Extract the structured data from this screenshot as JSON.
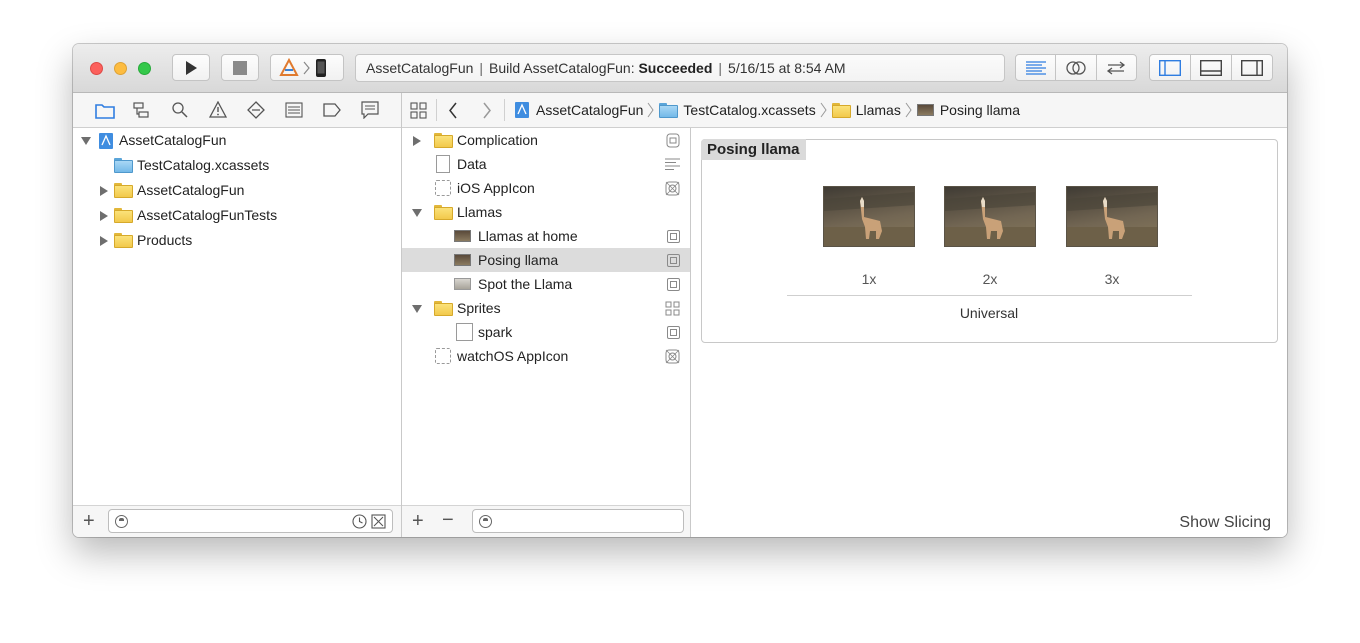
{
  "window": {
    "traffic_lights": {
      "close": "#fc605c",
      "minimize": "#fdbc40",
      "zoom": "#34c84a"
    },
    "toolbar": {
      "run_icon": "play-icon",
      "stop_icon": "stop-icon",
      "scheme_icon": "app-icon",
      "device_icon": "iphone-icon",
      "activity": {
        "project": "AssetCatalogFun",
        "build_prefix": "Build AssetCatalogFun:",
        "build_status": "Succeeded",
        "separator": "|",
        "timestamp": "5/16/15 at 8:54 AM"
      },
      "editor_buttons": [
        "standard-editor-icon",
        "assistant-editor-icon",
        "version-editor-icon"
      ],
      "view_buttons": [
        "navigator-toggle-icon",
        "debug-area-toggle-icon",
        "utilities-toggle-icon"
      ],
      "accent": "#2f7de1"
    }
  },
  "navigator": {
    "tabs": [
      "project-navigator-icon",
      "symbol-navigator-icon",
      "find-navigator-icon",
      "issue-navigator-icon",
      "test-navigator-icon",
      "debug-navigator-icon",
      "breakpoint-navigator-icon",
      "report-navigator-icon"
    ],
    "tree": [
      {
        "label": "AssetCatalogFun",
        "kind": "project"
      },
      {
        "label": "TestCatalog.xcassets",
        "kind": "asset-catalog"
      },
      {
        "label": "AssetCatalogFun",
        "kind": "folder"
      },
      {
        "label": "AssetCatalogFunTests",
        "kind": "folder"
      },
      {
        "label": "Products",
        "kind": "folder"
      }
    ],
    "footer": {
      "add": "+",
      "filter_placeholder": ""
    }
  },
  "jumpbar": {
    "crumbs": [
      "AssetCatalogFun",
      "TestCatalog.xcassets",
      "Llamas",
      "Posing llama"
    ]
  },
  "asset_list": {
    "items": [
      {
        "label": "Complication",
        "kind": "folder"
      },
      {
        "label": "Data",
        "kind": "data"
      },
      {
        "label": "iOS AppIcon",
        "kind": "appicon"
      },
      {
        "label": "Llamas",
        "kind": "folder"
      },
      {
        "label": "Llamas at home",
        "kind": "image"
      },
      {
        "label": "Posing llama",
        "kind": "image",
        "selected": true
      },
      {
        "label": "Spot the Llama",
        "kind": "image"
      },
      {
        "label": "Sprites",
        "kind": "folder"
      },
      {
        "label": "spark",
        "kind": "image"
      },
      {
        "label": "watchOS AppIcon",
        "kind": "appicon"
      }
    ],
    "footer": {
      "add": "+",
      "remove": "−",
      "filter_placeholder": ""
    }
  },
  "editor": {
    "asset_name": "Posing llama",
    "slots": [
      "1x",
      "2x",
      "3x"
    ],
    "idiom": "Universal",
    "show_slicing": "Show Slicing"
  }
}
